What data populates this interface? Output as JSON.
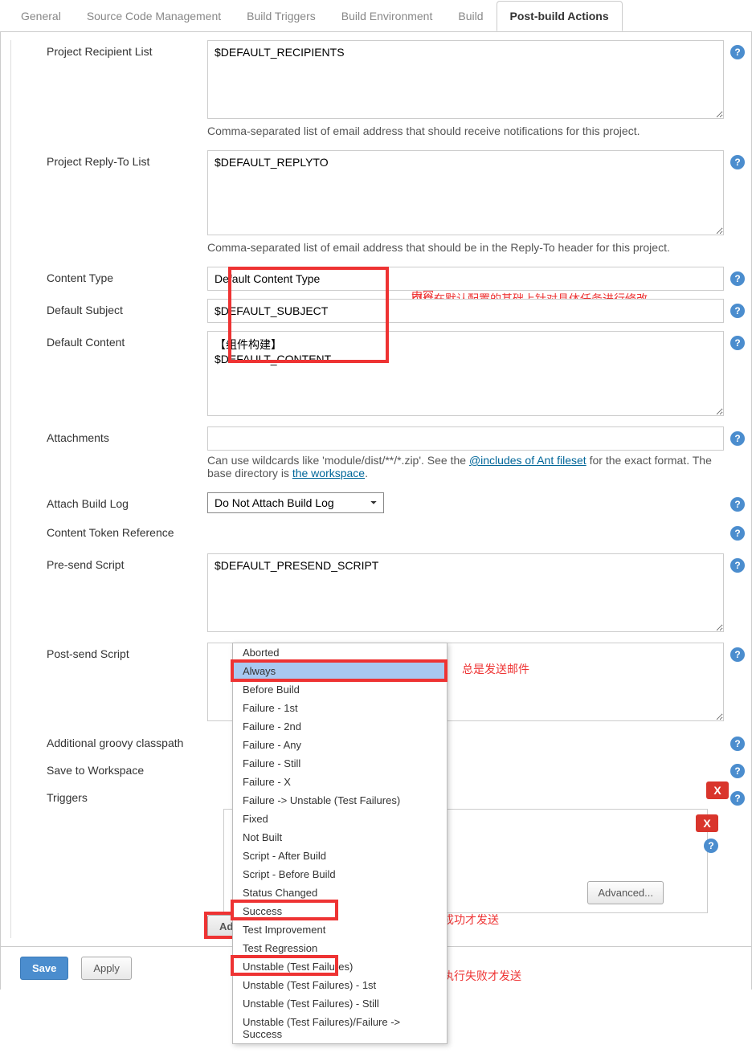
{
  "tabs": {
    "items": [
      "General",
      "Source Code Management",
      "Build Triggers",
      "Build Environment",
      "Build",
      "Post-build Actions"
    ],
    "active": 5
  },
  "fields": {
    "recipient_label": "Project Recipient List",
    "recipient_value": "$DEFAULT_RECIPIENTS",
    "recipient_help": "Comma-separated list of email address that should receive notifications for this project.",
    "replyto_label": "Project Reply-To List",
    "replyto_value": "$DEFAULT_REPLYTO",
    "replyto_help": "Comma-separated list of email address that should be in the Reply-To header for this project.",
    "content_type_label": "Content Type",
    "content_type_value": "Default Content Type",
    "default_subject_label": "Default Subject",
    "default_subject_value": "$DEFAULT_SUBJECT",
    "default_content_label": "Default Content",
    "default_content_value": "【组件构建】\n$DEFAULT_CONTENT",
    "attachments_label": "Attachments",
    "attachments_value": "",
    "attachments_help_pre": "Can use wildcards like 'module/dist/**/*.zip'. See the ",
    "attachments_help_link1": "@includes of Ant fileset",
    "attachments_help_mid": " for the exact format. The base directory is ",
    "attachments_help_link2": "the workspace",
    "attachments_help_end": ".",
    "attach_log_label": "Attach Build Log",
    "attach_log_value": "Do Not Attach Build Log",
    "token_ref_label": "Content Token Reference",
    "presend_label": "Pre-send Script",
    "presend_value": "$DEFAULT_PRESEND_SCRIPT",
    "postsend_label": "Post-send Script",
    "postsend_value": "",
    "classpath_label": "Additional groovy classpath",
    "save_ws_label": "Save to Workspace",
    "triggers_label": "Triggers",
    "advanced_btn": "Advanced...",
    "add_trigger_btn": "Add Trigger"
  },
  "annotations": {
    "top1": "$DEFAULT_SUBJECT和$DEFAULT_CONTENT为默认配置里的内容。",
    "top2": "可以在默认配置的基础上针对具体任务进行修改。",
    "always": "总是发送邮件",
    "success": "只在任务执行成功才发送",
    "fail": "只在任务执行失败才发送"
  },
  "trigger_menu": [
    "Aborted",
    "Always",
    "Before Build",
    "Failure - 1st",
    "Failure - 2nd",
    "Failure - Any",
    "Failure - Still",
    "Failure - X",
    "Failure -> Unstable (Test Failures)",
    "Fixed",
    "Not Built",
    "Script - After Build",
    "Script - Before Build",
    "Status Changed",
    "Success",
    "Test Improvement",
    "Test Regression",
    "Unstable (Test Failures)",
    "Unstable (Test Failures) - 1st",
    "Unstable (Test Failures) - Still",
    "Unstable (Test Failures)/Failure -> Success"
  ],
  "footer": {
    "save": "Save",
    "apply": "Apply"
  }
}
